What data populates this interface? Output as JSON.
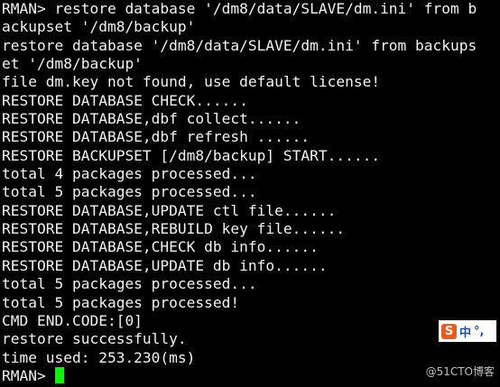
{
  "terminal": {
    "lines": [
      "RMAN> restore database '/dm8/data/SLAVE/dm.ini' from b",
      "ackupset '/dm8/backup'",
      "restore database '/dm8/data/SLAVE/dm.ini' from backups",
      "et '/dm8/backup'",
      "file dm.key not found, use default license!",
      "RESTORE DATABASE CHECK......",
      "RESTORE DATABASE,dbf collect......",
      "RESTORE DATABASE,dbf refresh ......",
      "RESTORE BACKUPSET [/dm8/backup] START......",
      "total 4 packages processed...",
      "total 5 packages processed...",
      "RESTORE DATABASE,UPDATE ctl file......",
      "RESTORE DATABASE,REBUILD key file......",
      "RESTORE DATABASE,CHECK db info......",
      "RESTORE DATABASE,UPDATE db info......",
      "total 5 packages processed...",
      "total 5 packages processed!",
      "CMD END.CODE:[0]",
      "restore successfully.",
      "time used: 253.230(ms)"
    ],
    "prompt": "RMAN> "
  },
  "ime": {
    "logo": "S",
    "mode": "中",
    "punct": "°,"
  },
  "watermark": "@51CTO博客",
  "colors": {
    "background": "#000000",
    "text": "#f2f2f2",
    "cursor": "#10f010"
  }
}
